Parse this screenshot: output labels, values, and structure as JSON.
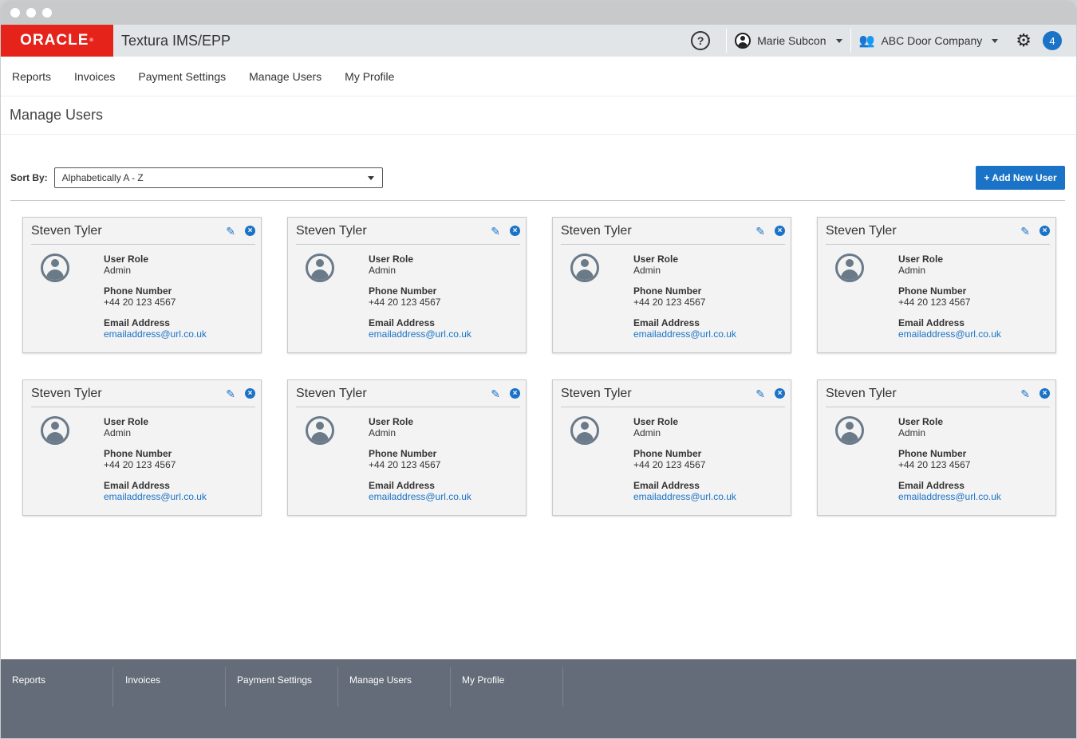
{
  "app": {
    "logo_text": "ORACLE",
    "product_title": "Textura IMS/EPP",
    "help_symbol": "?",
    "user_name": "Marie Subcon",
    "company_name": "ABC Door Company",
    "notification_count": "4"
  },
  "nav": {
    "items": [
      {
        "label": "Reports"
      },
      {
        "label": "Invoices"
      },
      {
        "label": "Payment Settings"
      },
      {
        "label": "Manage Users"
      },
      {
        "label": "My Profile"
      }
    ]
  },
  "page": {
    "title": "Manage Users",
    "sort_label": "Sort By:",
    "sort_value": "Alphabetically A - Z",
    "add_button": "+ Add New User"
  },
  "labels": {
    "role": "User Role",
    "phone": "Phone Number",
    "email": "Email Address"
  },
  "users": [
    {
      "name": "Steven Tyler",
      "role": "Admin",
      "phone": "+44 20 123 4567",
      "email": "emailaddress@url.co.uk"
    },
    {
      "name": "Steven Tyler",
      "role": "Admin",
      "phone": "+44 20 123 4567",
      "email": "emailaddress@url.co.uk"
    },
    {
      "name": "Steven Tyler",
      "role": "Admin",
      "phone": "+44 20 123 4567",
      "email": "emailaddress@url.co.uk"
    },
    {
      "name": "Steven Tyler",
      "role": "Admin",
      "phone": "+44 20 123 4567",
      "email": "emailaddress@url.co.uk"
    },
    {
      "name": "Steven Tyler",
      "role": "Admin",
      "phone": "+44 20 123 4567",
      "email": "emailaddress@url.co.uk"
    },
    {
      "name": "Steven Tyler",
      "role": "Admin",
      "phone": "+44 20 123 4567",
      "email": "emailaddress@url.co.uk"
    },
    {
      "name": "Steven Tyler",
      "role": "Admin",
      "phone": "+44 20 123 4567",
      "email": "emailaddress@url.co.uk"
    },
    {
      "name": "Steven Tyler",
      "role": "Admin",
      "phone": "+44 20 123 4567",
      "email": "emailaddress@url.co.uk"
    }
  ],
  "footer": {
    "items": [
      {
        "label": "Reports"
      },
      {
        "label": "Invoices"
      },
      {
        "label": "Payment Settings"
      },
      {
        "label": "Manage Users"
      },
      {
        "label": "My Profile"
      }
    ]
  },
  "colors": {
    "brand_red": "#e5231b",
    "accent_blue": "#1a73c6",
    "footer_bg": "#636c78"
  }
}
